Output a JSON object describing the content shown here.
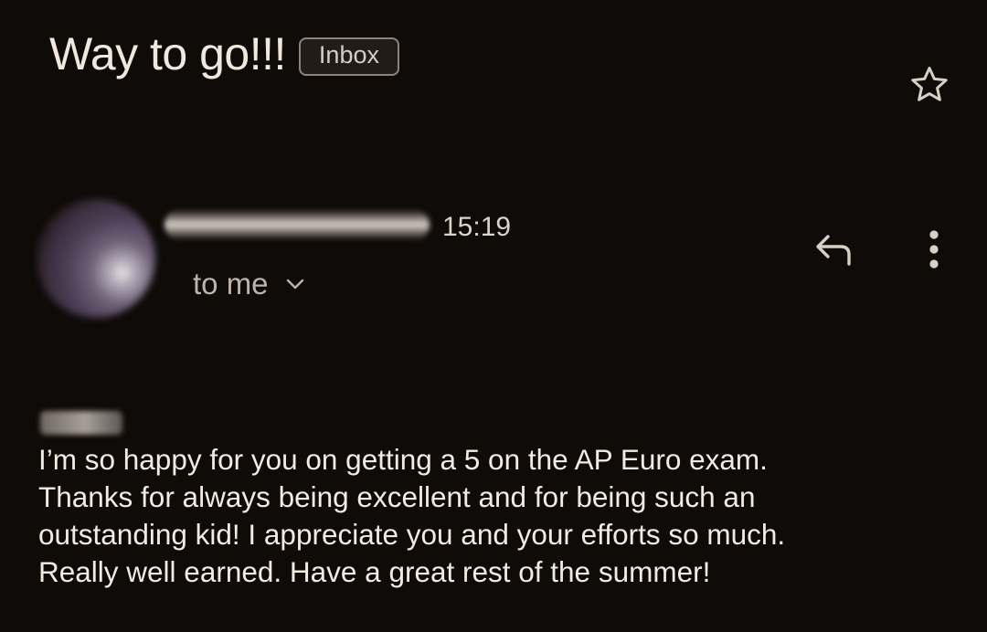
{
  "email": {
    "subject": "Way to go!!!",
    "label": "Inbox",
    "time": "15:19",
    "recipient": "to me",
    "body_lines": [
      "I’m so happy for you on getting a 5 on the AP Euro exam.",
      "Thanks for always being excellent and for being such an",
      "outstanding kid! I appreciate you and your efforts so much.",
      "Really well earned. Have a great rest of the summer!"
    ]
  },
  "icons": {
    "star": "star-icon",
    "reply": "reply-icon",
    "more": "more-vertical-icon",
    "expand": "chevron-down-icon"
  },
  "colors": {
    "background": "#0f0b08",
    "text": "#f3ebe2",
    "secondary_text": "#bdb3a9"
  }
}
